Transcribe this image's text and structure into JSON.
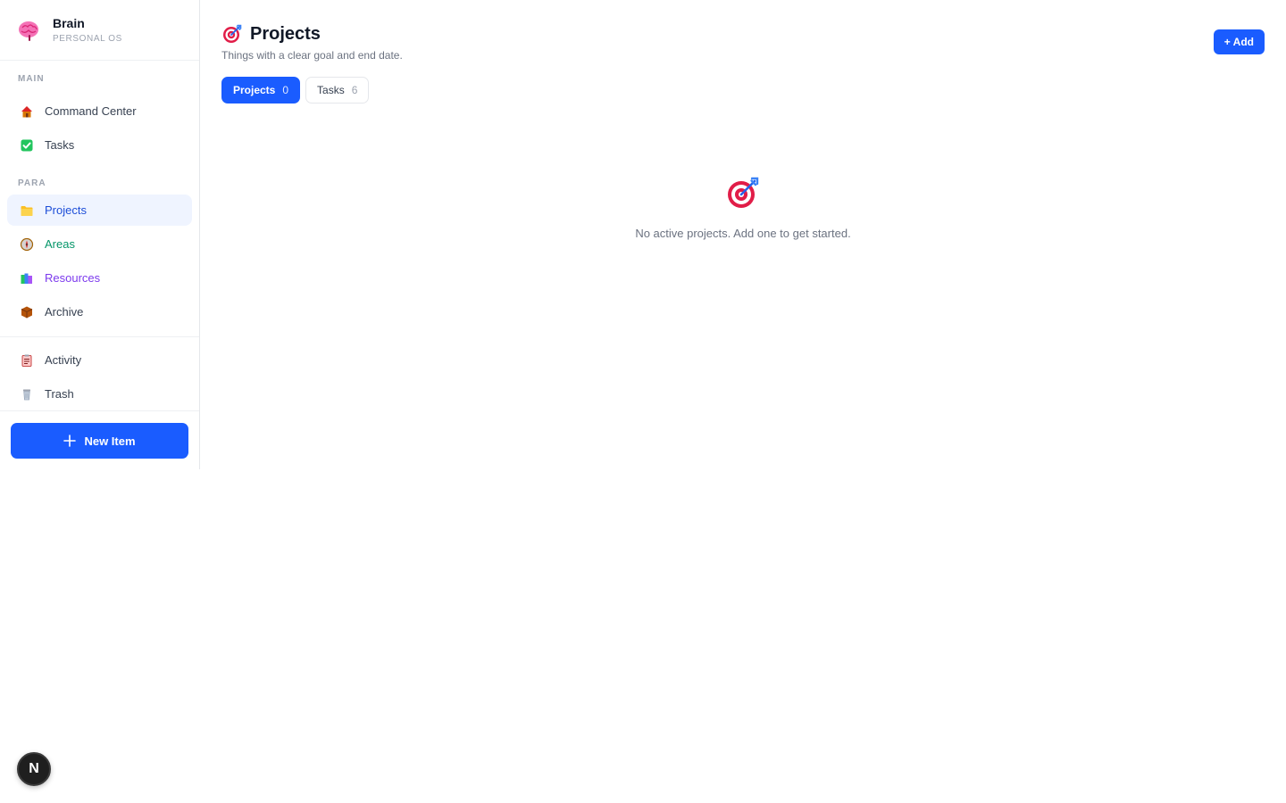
{
  "brand": {
    "name": "Brain",
    "subtitle": "PERSONAL OS"
  },
  "sidebar": {
    "main_label": "MAIN",
    "main_items": [
      {
        "label": "Command Center",
        "icon": "house-icon"
      },
      {
        "label": "Tasks",
        "icon": "checkbox-icon"
      }
    ],
    "para_label": "PARA",
    "para_items": [
      {
        "label": "Projects",
        "icon": "folder-icon",
        "active": true
      },
      {
        "label": "Areas",
        "icon": "compass-icon"
      },
      {
        "label": "Resources",
        "icon": "books-icon"
      },
      {
        "label": "Archive",
        "icon": "package-icon"
      }
    ],
    "other_items": [
      {
        "label": "Activity",
        "icon": "clipboard-icon"
      },
      {
        "label": "Trash",
        "icon": "trash-icon"
      }
    ],
    "new_item_label": "New Item"
  },
  "header": {
    "title": "Projects",
    "subtitle": "Things with a clear goal and end date.",
    "add_label": "+ Add"
  },
  "tabs": [
    {
      "label": "Projects",
      "count": "0",
      "active": true
    },
    {
      "label": "Tasks",
      "count": "6",
      "active": false
    }
  ],
  "empty_state": {
    "message": "No active projects. Add one to get started."
  },
  "badge": {
    "letter": "N"
  },
  "colors": {
    "accent": "#1a5cff",
    "active_bg": "#eff4ff",
    "areas": "#059669",
    "resources": "#7c3aed"
  }
}
